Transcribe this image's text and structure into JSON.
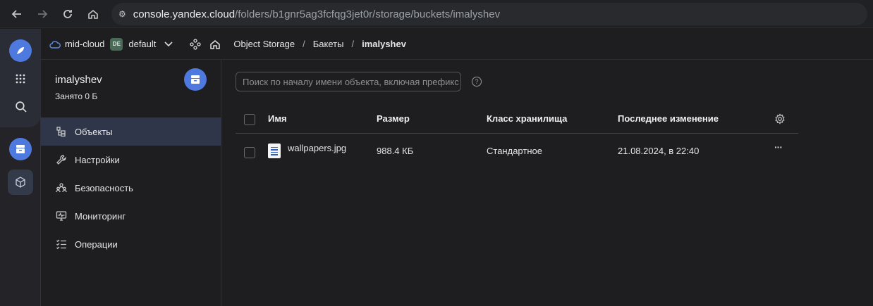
{
  "browser": {
    "url_host": "console.yandex.cloud",
    "url_path": "/folders/b1gnr5ag3fcfqg3jet0r/storage/buckets/imalyshev"
  },
  "topbar": {
    "cloud": "mid-cloud",
    "folder_badge": "DE",
    "folder": "default",
    "breadcrumb": [
      "Object Storage",
      "Бакеты",
      "imalyshev"
    ],
    "separator": "/"
  },
  "sidebar": {
    "bucket_name": "imalyshev",
    "used": "Занято 0 Б",
    "items": [
      {
        "label": "Объекты",
        "icon": "objects-icon"
      },
      {
        "label": "Настройки",
        "icon": "wrench-icon"
      },
      {
        "label": "Безопасность",
        "icon": "people-icon"
      },
      {
        "label": "Мониторинг",
        "icon": "monitor-icon"
      },
      {
        "label": "Операции",
        "icon": "list-icon"
      }
    ]
  },
  "main": {
    "search_placeholder": "Поиск по началу имени объекта, включая префикс",
    "help": "?",
    "columns": [
      "Имя",
      "Размер",
      "Класс хранилища",
      "Последнее изменение"
    ],
    "rows": [
      {
        "name": "wallpapers.jpg",
        "size": "988.4 КБ",
        "class": "Стандартное",
        "modified": "21.08.2024, в 22:40",
        "actions": "···"
      }
    ]
  },
  "colors": {
    "accent": "#4e7ae0",
    "active_item": "#2f3649",
    "background": "#1e1e21"
  }
}
